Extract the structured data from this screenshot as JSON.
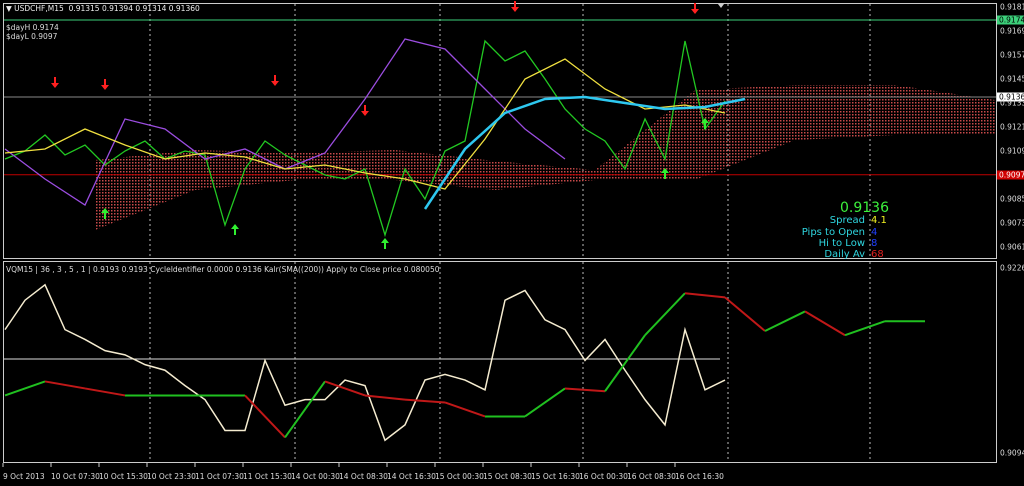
{
  "header": {
    "symbol": "USDCHF,M15",
    "ohlc": "0.91315 0.91394 0.91314 0.91360",
    "day_high": "$dayH 0.9174",
    "day_low": "$dayL 0.9097"
  },
  "indicator_header": "VQM15 | 36 , 3 , 5 , 1 | 0.9193 0.9193  CycleIdentifier 0.0000 0.9136  Kalr(SMA((200)) Apply to Close price 0.080050",
  "info_panel": {
    "price": "0.9136",
    "spread_label": "Spread",
    "spread": "4.1",
    "pips_label": "Pips to Open",
    "pips": "4",
    "hilo_label": "Hi to Low",
    "hilo": "8",
    "daily_label": "Daily Av",
    "daily": "68"
  },
  "colors": {
    "price_line": "#22c822",
    "cloud": "#c84a4a",
    "ma": "#2ec8f0",
    "purple": "#9b4de0",
    "yellow": "#f0e040",
    "high_line": "#3cd07a",
    "low_line": "#c00000",
    "current_line": "#888888"
  },
  "chart_data": [
    {
      "type": "line",
      "title": "USDCHF M15",
      "ylim": [
        0.9061,
        0.9181
      ],
      "y_ticks": [
        "0.91810",
        "0.91690",
        "0.91570",
        "0.91450",
        "0.91330",
        "0.91210",
        "0.91090",
        "0.90850",
        "0.90730",
        "0.90610"
      ],
      "y_tick_values": [
        0.9181,
        0.9169,
        0.9157,
        0.9145,
        0.9133,
        0.9121,
        0.9109,
        0.9085,
        0.9073,
        0.9061
      ],
      "markers": {
        "high": {
          "label": "0.91745",
          "value": 0.91745
        },
        "current": {
          "label": "0.91360",
          "value": 0.9136
        },
        "low": {
          "label": "0.90971",
          "value": 0.90971
        }
      },
      "series": [
        {
          "name": "close",
          "step": 2,
          "values": [
            0.9105,
            0.9109,
            0.9117,
            0.9107,
            0.9112,
            0.9102,
            0.9109,
            0.9114,
            0.9105,
            0.9109,
            0.9107,
            0.9072,
            0.91,
            0.9114,
            0.9107,
            0.9102,
            0.9097,
            0.9095,
            0.91,
            0.9067,
            0.91,
            0.9085,
            0.9109,
            0.9114,
            0.9164,
            0.9154,
            0.9159,
            0.9145,
            0.913,
            0.912,
            0.9114,
            0.91,
            0.9125,
            0.9105,
            0.9164,
            0.912,
            0.9134
          ]
        },
        {
          "name": "purple",
          "step": 4,
          "values": [
            0.911,
            0.9095,
            0.9082,
            0.9125,
            0.912,
            0.9105,
            0.911,
            0.91,
            0.9108,
            0.9135,
            0.9165,
            0.916,
            0.914,
            0.912,
            0.9105
          ]
        },
        {
          "name": "yellow",
          "step": 4,
          "values": [
            0.9108,
            0.911,
            0.912,
            0.9112,
            0.9105,
            0.9108,
            0.9106,
            0.91,
            0.9102,
            0.9098,
            0.9095,
            0.909,
            0.9115,
            0.9145,
            0.9155,
            0.914,
            0.913,
            0.9132,
            0.9128
          ]
        },
        {
          "name": "ma",
          "start": 42,
          "step": 4,
          "values": [
            0.908,
            0.911,
            0.9128,
            0.9135,
            0.9136,
            0.9133,
            0.913,
            0.9131,
            0.9135
          ]
        }
      ],
      "cloud": {
        "start": 9,
        "step": 10,
        "upper": [
          0.91045,
          0.91095,
          0.9108,
          0.91095,
          0.9104,
          0.90995,
          0.91395,
          0.9142,
          0.9142,
          0.91345
        ],
        "lower": [
          0.90695,
          0.90895,
          0.90945,
          0.90945,
          0.90895,
          0.90945,
          0.90945,
          0.91145,
          0.9117,
          0.9117
        ]
      },
      "arrows": [
        {
          "bar": 5,
          "value": 0.9143,
          "dir": "down"
        },
        {
          "bar": 10,
          "value": 0.9142,
          "dir": "down"
        },
        {
          "bar": 27,
          "value": 0.9144,
          "dir": "down"
        },
        {
          "bar": 36,
          "value": 0.9129,
          "dir": "down"
        },
        {
          "bar": 51,
          "value": 0.9181,
          "dir": "down"
        },
        {
          "bar": 69,
          "value": 0.918,
          "dir": "down"
        },
        {
          "bar": 10,
          "value": 0.9078,
          "dir": "up"
        },
        {
          "bar": 23,
          "value": 0.907,
          "dir": "up"
        },
        {
          "bar": 38,
          "value": 0.9063,
          "dir": "up"
        },
        {
          "bar": 66,
          "value": 0.9098,
          "dir": "up"
        },
        {
          "bar": 70,
          "value": 0.9123,
          "dir": "up"
        }
      ]
    },
    {
      "type": "line",
      "title": "VQM15",
      "ylim": [
        0.9094,
        0.9226
      ],
      "y_ticks": [
        "0.9226",
        "0.9094"
      ],
      "level": 0.9161,
      "series": [
        {
          "name": "oscillator",
          "step": 2,
          "values": [
            0.9182,
            0.9203,
            0.9214,
            0.9182,
            0.9175,
            0.9167,
            0.9164,
            0.9157,
            0.9153,
            0.9142,
            0.9132,
            0.911,
            0.911,
            0.916,
            0.9128,
            0.9132,
            0.9132,
            0.9146,
            0.9142,
            0.9103,
            0.9114,
            0.9146,
            0.915,
            0.9146,
            0.9139,
            0.9203,
            0.921,
            0.9189,
            0.9182,
            0.916,
            0.9175,
            0.9153,
            0.9132,
            0.9114,
            0.9182,
            0.9139,
            0.9146
          ]
        },
        {
          "name": "signal",
          "step": 4,
          "values": [
            0.9135,
            0.9145,
            0.914,
            0.9135,
            0.9135,
            0.9135,
            0.9135,
            0.9105,
            0.9145,
            0.9135,
            0.9132,
            0.913,
            0.912,
            0.912,
            0.914,
            0.9138,
            0.9178,
            0.9208,
            0.9205,
            0.9181,
            0.9195,
            0.9178,
            0.9188,
            0.9188
          ]
        }
      ]
    }
  ],
  "x_axis": [
    "9 Oct 2013",
    "10 Oct 07:30",
    "10 Oct 15:30",
    "10 Oct 23:30",
    "11 Oct 07:30",
    "11 Oct 15:30",
    "14 Oct 00:30",
    "14 Oct 08:30",
    "14 Oct 16:30",
    "15 Oct 00:30",
    "15 Oct 08:30",
    "15 Oct 16:30",
    "16 Oct 00:30",
    "16 Oct 08:30",
    "16 Oct 16:30"
  ]
}
